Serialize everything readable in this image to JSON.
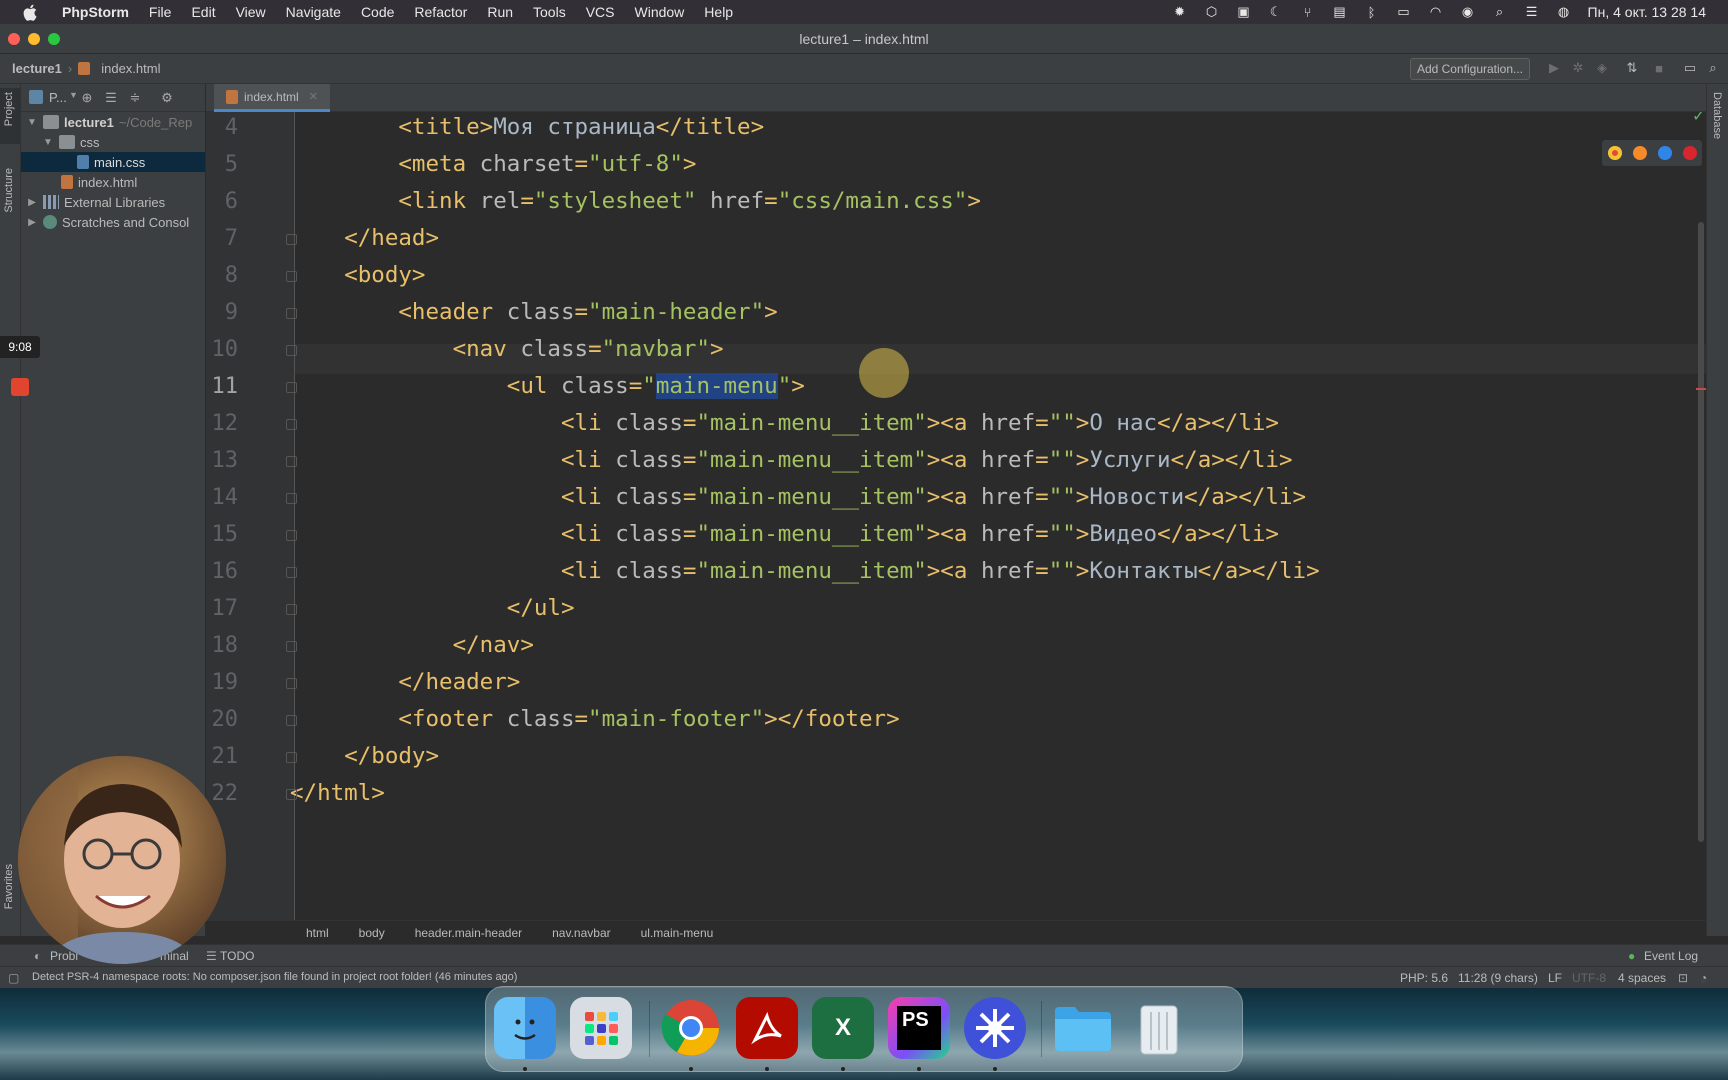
{
  "menubar": {
    "app": "PhpStorm",
    "items": [
      "File",
      "Edit",
      "View",
      "Navigate",
      "Code",
      "Refactor",
      "Run",
      "Tools",
      "VCS",
      "Window",
      "Help"
    ],
    "clock": "Пн, 4 окт.  13 28 14"
  },
  "window": {
    "title": "lecture1 – index.html"
  },
  "navbar": {
    "project": "lecture1",
    "file": "index.html",
    "add_config": "Add Configuration..."
  },
  "sidebar": {
    "project_tab": "Project",
    "structure_tab": "Structure",
    "favorites_tab": "Favorites",
    "header": "P..."
  },
  "tree": {
    "root": "lecture1",
    "root_path": "~/Code_Rep",
    "css": "css",
    "main_css": "main.css",
    "index": "index.html",
    "ext_libs": "External Libraries",
    "scratches": "Scratches and Consol"
  },
  "tab": {
    "label": "index.html"
  },
  "right_strip": {
    "database": "Database"
  },
  "editor": {
    "line_numbers": [
      "4",
      "5",
      "6",
      "7",
      "8",
      "9",
      "10",
      "11",
      "12",
      "13",
      "14",
      "15",
      "16",
      "17",
      "18",
      "19",
      "20",
      "21",
      "22"
    ],
    "lines": [
      {
        "indent": "        ",
        "parts": [
          [
            "tag",
            "<title>"
          ],
          [
            "txt",
            "Моя страница"
          ],
          [
            "tag",
            "</title>"
          ]
        ]
      },
      {
        "indent": "        ",
        "parts": [
          [
            "tag",
            "<meta "
          ],
          [
            "attr",
            "charset"
          ],
          [
            "tag",
            "="
          ],
          [
            "val",
            "\"utf-8\""
          ],
          [
            "tag",
            ">"
          ]
        ]
      },
      {
        "indent": "        ",
        "parts": [
          [
            "tag",
            "<link "
          ],
          [
            "attr",
            "rel"
          ],
          [
            "tag",
            "="
          ],
          [
            "val",
            "\"stylesheet\""
          ],
          [
            "attr",
            " href"
          ],
          [
            "tag",
            "="
          ],
          [
            "val",
            "\"css/main.css\""
          ],
          [
            "tag",
            ">"
          ]
        ]
      },
      {
        "indent": "    ",
        "parts": [
          [
            "tag",
            "</head>"
          ]
        ]
      },
      {
        "indent": "    ",
        "parts": [
          [
            "tag",
            "<body>"
          ]
        ]
      },
      {
        "indent": "        ",
        "parts": [
          [
            "tag",
            "<header "
          ],
          [
            "attr",
            "class"
          ],
          [
            "tag",
            "="
          ],
          [
            "val",
            "\"main-header\""
          ],
          [
            "tag",
            ">"
          ]
        ]
      },
      {
        "indent": "            ",
        "parts": [
          [
            "tag",
            "<nav "
          ],
          [
            "attr",
            "class"
          ],
          [
            "tag",
            "="
          ],
          [
            "val",
            "\"navbar\""
          ],
          [
            "tag",
            ">"
          ]
        ]
      },
      {
        "indent": "                ",
        "parts": [
          [
            "tag",
            "<ul "
          ],
          [
            "attr",
            "class"
          ],
          [
            "tag",
            "="
          ],
          [
            "val",
            "\""
          ],
          [
            "hl",
            "main-menu"
          ],
          [
            "val",
            "\""
          ],
          [
            "tag",
            ">"
          ]
        ]
      },
      {
        "indent": "                    ",
        "parts": [
          [
            "tag",
            "<li "
          ],
          [
            "attr",
            "class"
          ],
          [
            "tag",
            "="
          ],
          [
            "val",
            "\"main-menu__item\""
          ],
          [
            "tag",
            "><a "
          ],
          [
            "attr",
            "href"
          ],
          [
            "tag",
            "="
          ],
          [
            "val",
            "\"\""
          ],
          [
            "tag",
            ">"
          ],
          [
            "txt",
            "О нас"
          ],
          [
            "tag",
            "</a></li>"
          ]
        ]
      },
      {
        "indent": "                    ",
        "parts": [
          [
            "tag",
            "<li "
          ],
          [
            "attr",
            "class"
          ],
          [
            "tag",
            "="
          ],
          [
            "val",
            "\"main-menu__item\""
          ],
          [
            "tag",
            "><a "
          ],
          [
            "attr",
            "href"
          ],
          [
            "tag",
            "="
          ],
          [
            "val",
            "\"\""
          ],
          [
            "tag",
            ">"
          ],
          [
            "txt",
            "Услуги"
          ],
          [
            "tag",
            "</a></li>"
          ]
        ]
      },
      {
        "indent": "                    ",
        "parts": [
          [
            "tag",
            "<li "
          ],
          [
            "attr",
            "class"
          ],
          [
            "tag",
            "="
          ],
          [
            "val",
            "\"main-menu__item\""
          ],
          [
            "tag",
            "><a "
          ],
          [
            "attr",
            "href"
          ],
          [
            "tag",
            "="
          ],
          [
            "val",
            "\"\""
          ],
          [
            "tag",
            ">"
          ],
          [
            "txt",
            "Новости"
          ],
          [
            "tag",
            "</a></li>"
          ]
        ]
      },
      {
        "indent": "                    ",
        "parts": [
          [
            "tag",
            "<li "
          ],
          [
            "attr",
            "class"
          ],
          [
            "tag",
            "="
          ],
          [
            "val",
            "\"main-menu__item\""
          ],
          [
            "tag",
            "><a "
          ],
          [
            "attr",
            "href"
          ],
          [
            "tag",
            "="
          ],
          [
            "val",
            "\"\""
          ],
          [
            "tag",
            ">"
          ],
          [
            "txt",
            "Видео"
          ],
          [
            "tag",
            "</a></li>"
          ]
        ]
      },
      {
        "indent": "                    ",
        "parts": [
          [
            "tag",
            "<li "
          ],
          [
            "attr",
            "class"
          ],
          [
            "tag",
            "="
          ],
          [
            "val",
            "\"main-menu__item\""
          ],
          [
            "tag",
            "><a "
          ],
          [
            "attr",
            "href"
          ],
          [
            "tag",
            "="
          ],
          [
            "val",
            "\"\""
          ],
          [
            "tag",
            ">"
          ],
          [
            "txt",
            "Контакты"
          ],
          [
            "tag",
            "</a></li>"
          ]
        ]
      },
      {
        "indent": "                ",
        "parts": [
          [
            "tag",
            "</ul>"
          ]
        ]
      },
      {
        "indent": "            ",
        "parts": [
          [
            "tag",
            "</nav>"
          ]
        ]
      },
      {
        "indent": "        ",
        "parts": [
          [
            "tag",
            "</header>"
          ]
        ]
      },
      {
        "indent": "        ",
        "parts": [
          [
            "tag",
            "<footer "
          ],
          [
            "attr",
            "class"
          ],
          [
            "tag",
            "="
          ],
          [
            "val",
            "\"main-footer\""
          ],
          [
            "tag",
            "></footer>"
          ]
        ]
      },
      {
        "indent": "    ",
        "parts": [
          [
            "tag",
            "</body>"
          ]
        ]
      },
      {
        "indent": "",
        "parts": [
          [
            "tag",
            "</html>"
          ]
        ]
      }
    ]
  },
  "breadcrumbs": [
    "html",
    "body",
    "header.main-header",
    "nav.navbar",
    "ul.main-menu"
  ],
  "toolwindows": {
    "problems": "Probl",
    "terminal": "minal",
    "todo": "TODO",
    "event_log": "Event Log"
  },
  "status": {
    "message": "Detect PSR-4 namespace roots: No composer.json file found in project root folder! (46 minutes ago)",
    "php": "PHP: 5.6",
    "position": "11:28 (9 chars)",
    "line_sep": "LF",
    "encoding": "UTF-8",
    "indent": "4 spaces"
  },
  "recording": {
    "time": "9:08"
  },
  "dock": {
    "apps": [
      "finder-icon",
      "launchpad-icon",
      "chrome-icon",
      "acrobat-icon",
      "excel-icon",
      "phpstorm-icon",
      "bitwarden-icon",
      "folder-icon",
      "trash-icon"
    ],
    "ps_label": "PS",
    "x_label": "X"
  }
}
